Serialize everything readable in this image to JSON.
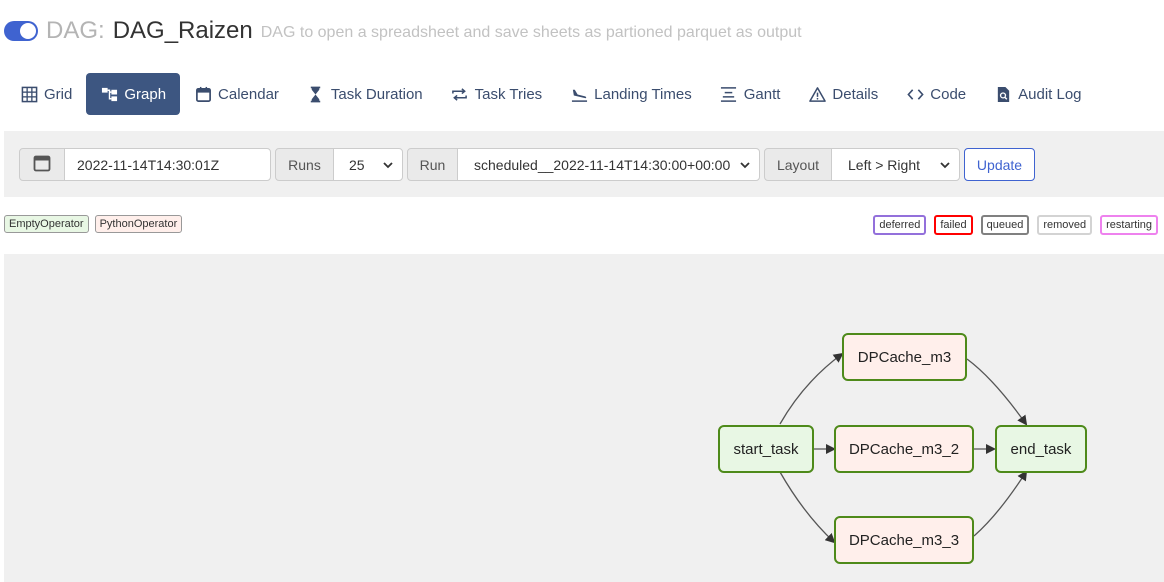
{
  "header": {
    "prefix": "DAG:",
    "dag_id": "DAG_Raizen",
    "description": "DAG to open a spreadsheet and save sheets as partioned parquet as output"
  },
  "nav": {
    "tabs": [
      {
        "label": "Grid",
        "icon": "grid-icon"
      },
      {
        "label": "Graph",
        "icon": "graph-icon",
        "active": true
      },
      {
        "label": "Calendar",
        "icon": "calendar-icon"
      },
      {
        "label": "Task Duration",
        "icon": "hourglass-icon"
      },
      {
        "label": "Task Tries",
        "icon": "retry-icon"
      },
      {
        "label": "Landing Times",
        "icon": "plane-landing-icon"
      },
      {
        "label": "Gantt",
        "icon": "gantt-icon"
      },
      {
        "label": "Details",
        "icon": "warning-icon"
      },
      {
        "label": "Code",
        "icon": "code-icon"
      },
      {
        "label": "Audit Log",
        "icon": "file-search-icon"
      }
    ]
  },
  "toolbar": {
    "base_date": "2022-11-14T14:30:01Z",
    "runs_label": "Runs",
    "runs_value": "25",
    "run_label": "Run",
    "run_value": "scheduled__2022-11-14T14:30:00+00:00",
    "layout_label": "Layout",
    "layout_value": "Left > Right",
    "update_label": "Update"
  },
  "legend": {
    "operators": [
      {
        "label": "EmptyOperator",
        "color": "#e8f7e4"
      },
      {
        "label": "PythonOperator",
        "color": "#ffefeb"
      }
    ],
    "states": [
      {
        "label": "deferred",
        "color": "#9370db"
      },
      {
        "label": "failed",
        "color": "#ff0000"
      },
      {
        "label": "queued",
        "color": "#808080"
      },
      {
        "label": "removed",
        "color": "#d3d3d3"
      },
      {
        "label": "restarting",
        "color": "#ee82ee"
      }
    ]
  },
  "graph": {
    "nodes": [
      {
        "id": "start_task",
        "label": "start_task",
        "operator": "EmptyOperator"
      },
      {
        "id": "DPCache_m3",
        "label": "DPCache_m3",
        "operator": "PythonOperator"
      },
      {
        "id": "DPCache_m3_2",
        "label": "DPCache_m3_2",
        "operator": "PythonOperator"
      },
      {
        "id": "DPCache_m3_3",
        "label": "DPCache_m3_3",
        "operator": "PythonOperator"
      },
      {
        "id": "end_task",
        "label": "end_task",
        "operator": "EmptyOperator"
      }
    ],
    "edges": [
      [
        "start_task",
        "DPCache_m3"
      ],
      [
        "start_task",
        "DPCache_m3_2"
      ],
      [
        "start_task",
        "DPCache_m3_3"
      ],
      [
        "DPCache_m3",
        "end_task"
      ],
      [
        "DPCache_m3_2",
        "end_task"
      ],
      [
        "DPCache_m3_3",
        "end_task"
      ]
    ]
  },
  "colors": {
    "accent": "#3f63d0",
    "active_tab": "#3d5681",
    "node_border": "#4e8a1a"
  }
}
